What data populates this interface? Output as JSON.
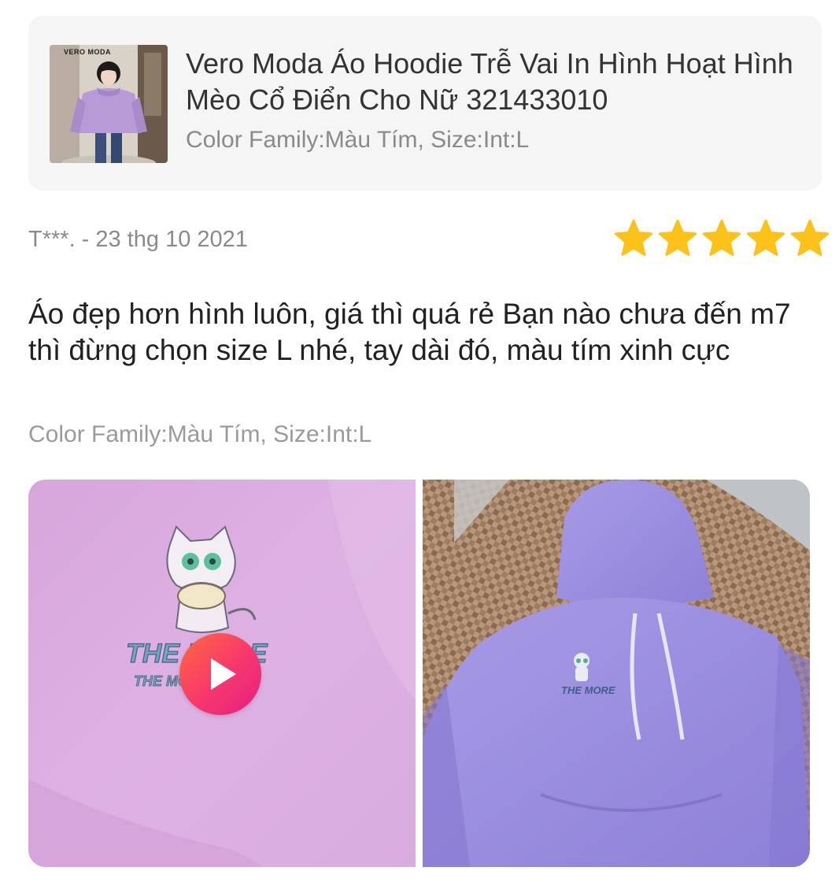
{
  "product": {
    "title": "Vero Moda Áo Hoodie Trễ Vai In Hình Hoạt Hình Mèo Cổ Điển Cho Nữ 321433010",
    "variant": "Color Family:Màu Tím, Size:Int:L",
    "thumbnail_brand": "VERO MODA"
  },
  "review": {
    "author_date": "T***. - 23 thg 10 2021",
    "rating": 5,
    "star_color": "#fcc219",
    "text": "Áo đẹp hơn hình luôn, giá thì quá rẻ Bạn nào chưa đến m7 thì đừng chọn size L nhé, tay dài đó, màu tím xinh cực",
    "variant": "Color Family:Màu Tím, Size:Int:L"
  },
  "media": [
    {
      "kind": "video",
      "icon": "play-icon",
      "print_text": "THE MORE"
    },
    {
      "kind": "photo",
      "print_text": "THE MORE"
    }
  ]
}
